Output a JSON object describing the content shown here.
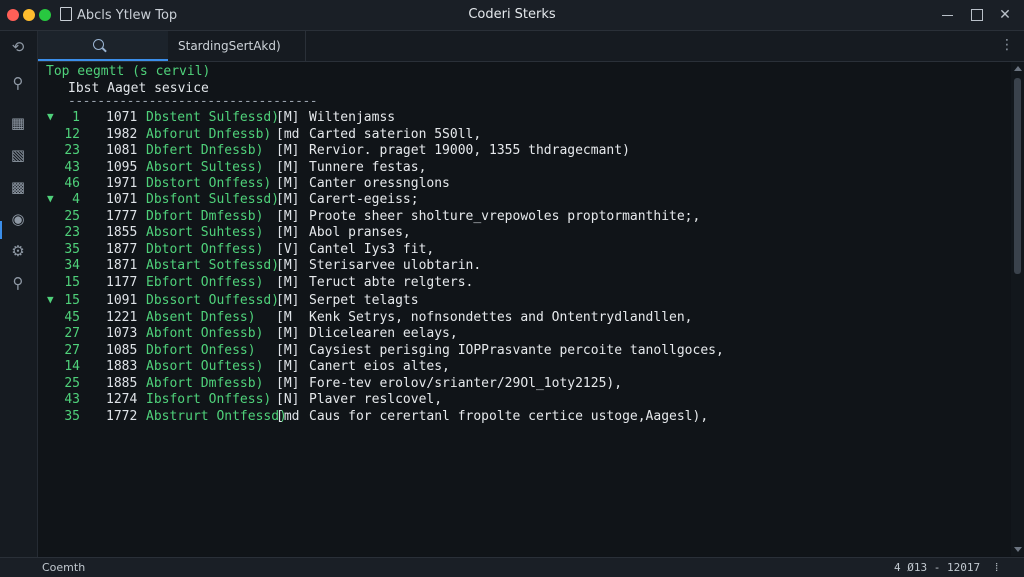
{
  "window": {
    "menu_text": "Abcls  Ytlew  Top",
    "title": "Coderi Sterks"
  },
  "tabs": {
    "file_tab_label": "StardingSertAkd)",
    "more_glyph": "⋮"
  },
  "terminal": {
    "command": "Top eegmtt (s cervil)",
    "subheading": "Ibst Aaget sesvice",
    "separator": "----------------------------------",
    "groups": [
      {
        "rows": [
          {
            "caret": "▼",
            "id": "1",
            "num": "1071",
            "status": "Dbstent Sulfessd)",
            "flag": "[M]",
            "message": "Wiltenjamss"
          },
          {
            "caret": "",
            "id": "12",
            "num": "1982",
            "status": "Abforut Dnfessb)",
            "flag": "[md",
            "message": "Carted saterion 5S0ll,"
          },
          {
            "caret": "",
            "id": "23",
            "num": "1081",
            "status": "Dbfert Dnfessb)",
            "flag": "[M]",
            "message": "Rervior. praget 19000, 1355 thdragecmant)"
          },
          {
            "caret": "",
            "id": "43",
            "num": "1095",
            "status": "Absort Sultess)",
            "flag": "[M]",
            "message": "Tunnere festas,"
          },
          {
            "caret": "",
            "id": "46",
            "num": "1971",
            "status": "Dbstort Onffess)",
            "flag": "[M]",
            "message": "Canter oressnglons"
          }
        ]
      },
      {
        "rows": [
          {
            "caret": "▼",
            "id": "4",
            "num": "1071",
            "status": "Dbsfont Sulfessd)",
            "flag": "[M]",
            "message": "Carert-egeiss;"
          },
          {
            "caret": "",
            "id": "25",
            "num": "1777",
            "status": "Dbfort Dmfessb)",
            "flag": "[M]",
            "message": "Proote sheer sholture_vrepowoles proptormanthite;,"
          },
          {
            "caret": "",
            "id": "23",
            "num": "1855",
            "status": "Absort Suhtess)",
            "flag": "[M]",
            "message": "Abol pranses,"
          },
          {
            "caret": "",
            "id": "35",
            "num": "1877",
            "status": "Dbtort Onffess)",
            "flag": "[V]",
            "message": "Cantel Iys3 fit,"
          },
          {
            "caret": "",
            "id": "34",
            "num": "1871",
            "status": "Abstart Sotfessd)",
            "flag": "[M]",
            "message": "Sterisarvee ulobtarin."
          },
          {
            "caret": "",
            "id": "15",
            "num": "1177",
            "status": "Ebfort Onffess)",
            "flag": "[M]",
            "message": "Teruct abte relgters."
          }
        ]
      },
      {
        "rows": [
          {
            "caret": "▼",
            "id": "15",
            "num": "1091",
            "status": "Dbssort Ouffessd)",
            "flag": "[M]",
            "message": "Serpet telagts"
          },
          {
            "caret": "",
            "id": "45",
            "num": "1221",
            "status": "Absent Dnfess)",
            "flag": "[M",
            "message": "Kenk Setrys, nofnsondettes and Ontentrydlandllen,"
          },
          {
            "caret": "",
            "id": "27",
            "num": "1073",
            "status": "Abfont Onfessb)",
            "flag": "[M]",
            "message": "Dlicelearen eelays,"
          },
          {
            "caret": "",
            "id": "27",
            "num": "1085",
            "status": "Dbfort Onfess)",
            "flag": "[M]",
            "message": "Caysiest perisging IOPPrasvante percoite tanollgoces,"
          },
          {
            "caret": "",
            "id": "14",
            "num": "1883",
            "status": "Absort Ouftess)",
            "flag": "[M]",
            "message": "Canert eios altes,"
          },
          {
            "caret": "",
            "id": "25",
            "num": "1885",
            "status": "Abfort Dmfessb)",
            "flag": "[M]",
            "message": "Fore-tev erolov/srianter/29Ol_1oty2125),"
          },
          {
            "caret": "",
            "id": "43",
            "num": "1274",
            "status": "Ibsfort Onffess)",
            "flag": "[N]",
            "message": "Plaver reslcovel,"
          },
          {
            "caret": "",
            "id": "35",
            "num": "1772",
            "status": "Abstrurt Ontfessd)",
            "flag": "[md",
            "message": "Caus for cerertanl fropolte certice ustoge,Aagesl),"
          }
        ]
      }
    ]
  },
  "statusbar": {
    "left_text": "Coemth",
    "right_text": "4 Ø13 - 12017  ⁞"
  },
  "colors": {
    "accent": "#3b8eea",
    "terminal_green": "#4fd17a",
    "background": "#101418"
  },
  "icons": [
    "doc-icon",
    "search-icon",
    "min-icon",
    "max-icon",
    "close-icon",
    "explorer-icon",
    "search-side-icon",
    "scm-icon",
    "debug-icon",
    "extensions-icon",
    "remote-icon",
    "settings-icon",
    "account-icon"
  ]
}
